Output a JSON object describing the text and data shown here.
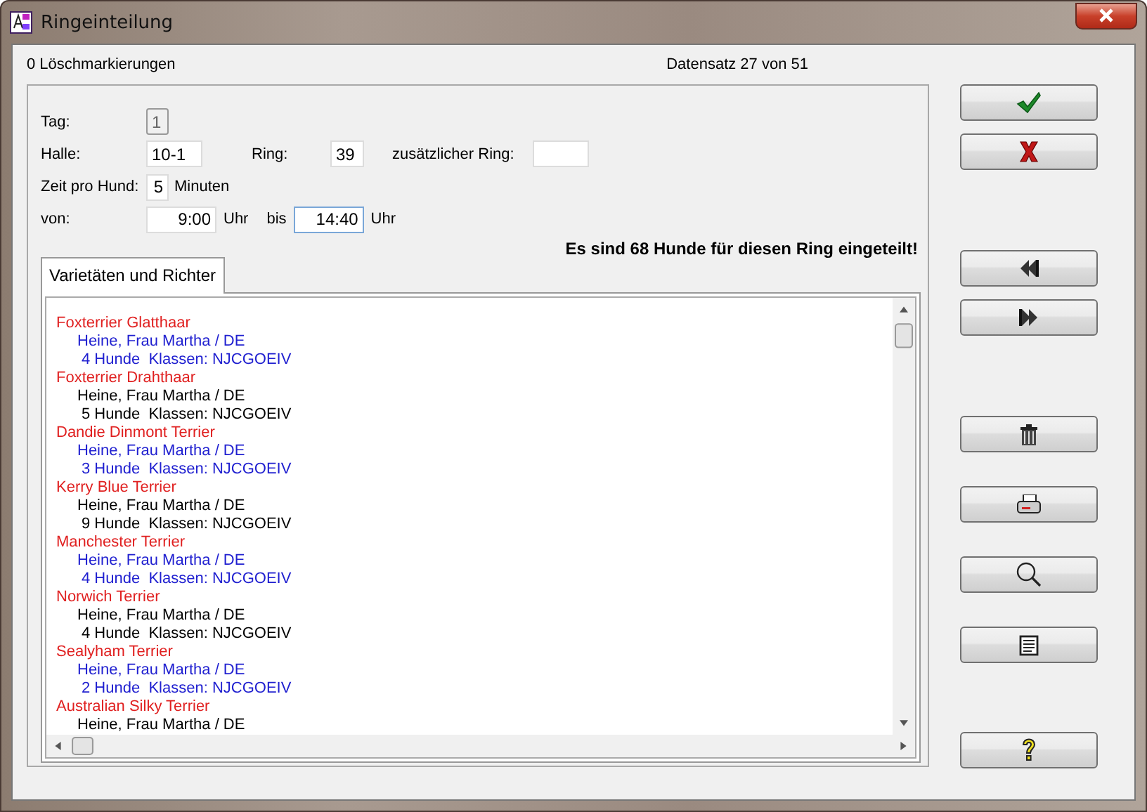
{
  "window": {
    "title": "Ringeinteilung"
  },
  "header": {
    "deletion_marks": "0 Löschmarkierungen",
    "record": "Datensatz 27 von 51"
  },
  "form": {
    "day": {
      "label": "Tag:",
      "value": "1",
      "disabled": true
    },
    "hall": {
      "label": "Halle:",
      "value": "10-1"
    },
    "ring": {
      "label": "Ring:",
      "value": "39"
    },
    "extra_ring": {
      "label": "zusätzlicher Ring:"
    },
    "time_per_dog": {
      "label": "Zeit pro Hund:",
      "value": "5",
      "unit": "Minuten"
    },
    "from": {
      "label": "von:",
      "value": "9:00",
      "unit": "Uhr",
      "focused": false
    },
    "to": {
      "label": "bis",
      "value": "14:40",
      "unit": "Uhr",
      "focused": true
    }
  },
  "message": "Es sind 68 Hunde für diesen Ring eingeteilt!",
  "tabs": [
    {
      "label": "Varietäten und Richter",
      "selected": true
    }
  ],
  "breeds": [
    {
      "name": "Foxterrier Glatthaar",
      "judge": "Heine, Frau Martha / DE",
      "count": "4 Hunde  Klassen: NJCGOEIV",
      "color": "#2020d0"
    },
    {
      "name": "Foxterrier Drahthaar",
      "judge": "Heine, Frau Martha / DE",
      "count": "5 Hunde  Klassen: NJCGOEIV",
      "color": "#000000"
    },
    {
      "name": "Dandie Dinmont Terrier",
      "judge": "Heine, Frau Martha / DE",
      "count": "3 Hunde  Klassen: NJCGOEIV",
      "color": "#2020d0"
    },
    {
      "name": "Kerry Blue Terrier",
      "judge": "Heine, Frau Martha / DE",
      "count": "9 Hunde  Klassen: NJCGOEIV",
      "color": "#000000"
    },
    {
      "name": "Manchester Terrier",
      "judge": "Heine, Frau Martha / DE",
      "count": "4 Hunde  Klassen: NJCGOEIV",
      "color": "#2020d0"
    },
    {
      "name": "Norwich Terrier",
      "judge": "Heine, Frau Martha / DE",
      "count": "4 Hunde  Klassen: NJCGOEIV",
      "color": "#000000"
    },
    {
      "name": "Sealyham Terrier",
      "judge": "Heine, Frau Martha / DE",
      "count": "2 Hunde  Klassen: NJCGOEIV",
      "color": "#2020d0"
    },
    {
      "name": "Australian Silky Terrier",
      "judge": "Heine, Frau Martha / DE",
      "color": "#000000"
    }
  ],
  "buttons": [
    {
      "kind": "ok"
    },
    {
      "kind": "cancel"
    },
    {
      "kind": "first"
    },
    {
      "kind": "last"
    },
    {
      "kind": "delete"
    },
    {
      "kind": "print"
    },
    {
      "kind": "search"
    },
    {
      "kind": "report"
    },
    {
      "kind": "help"
    }
  ]
}
